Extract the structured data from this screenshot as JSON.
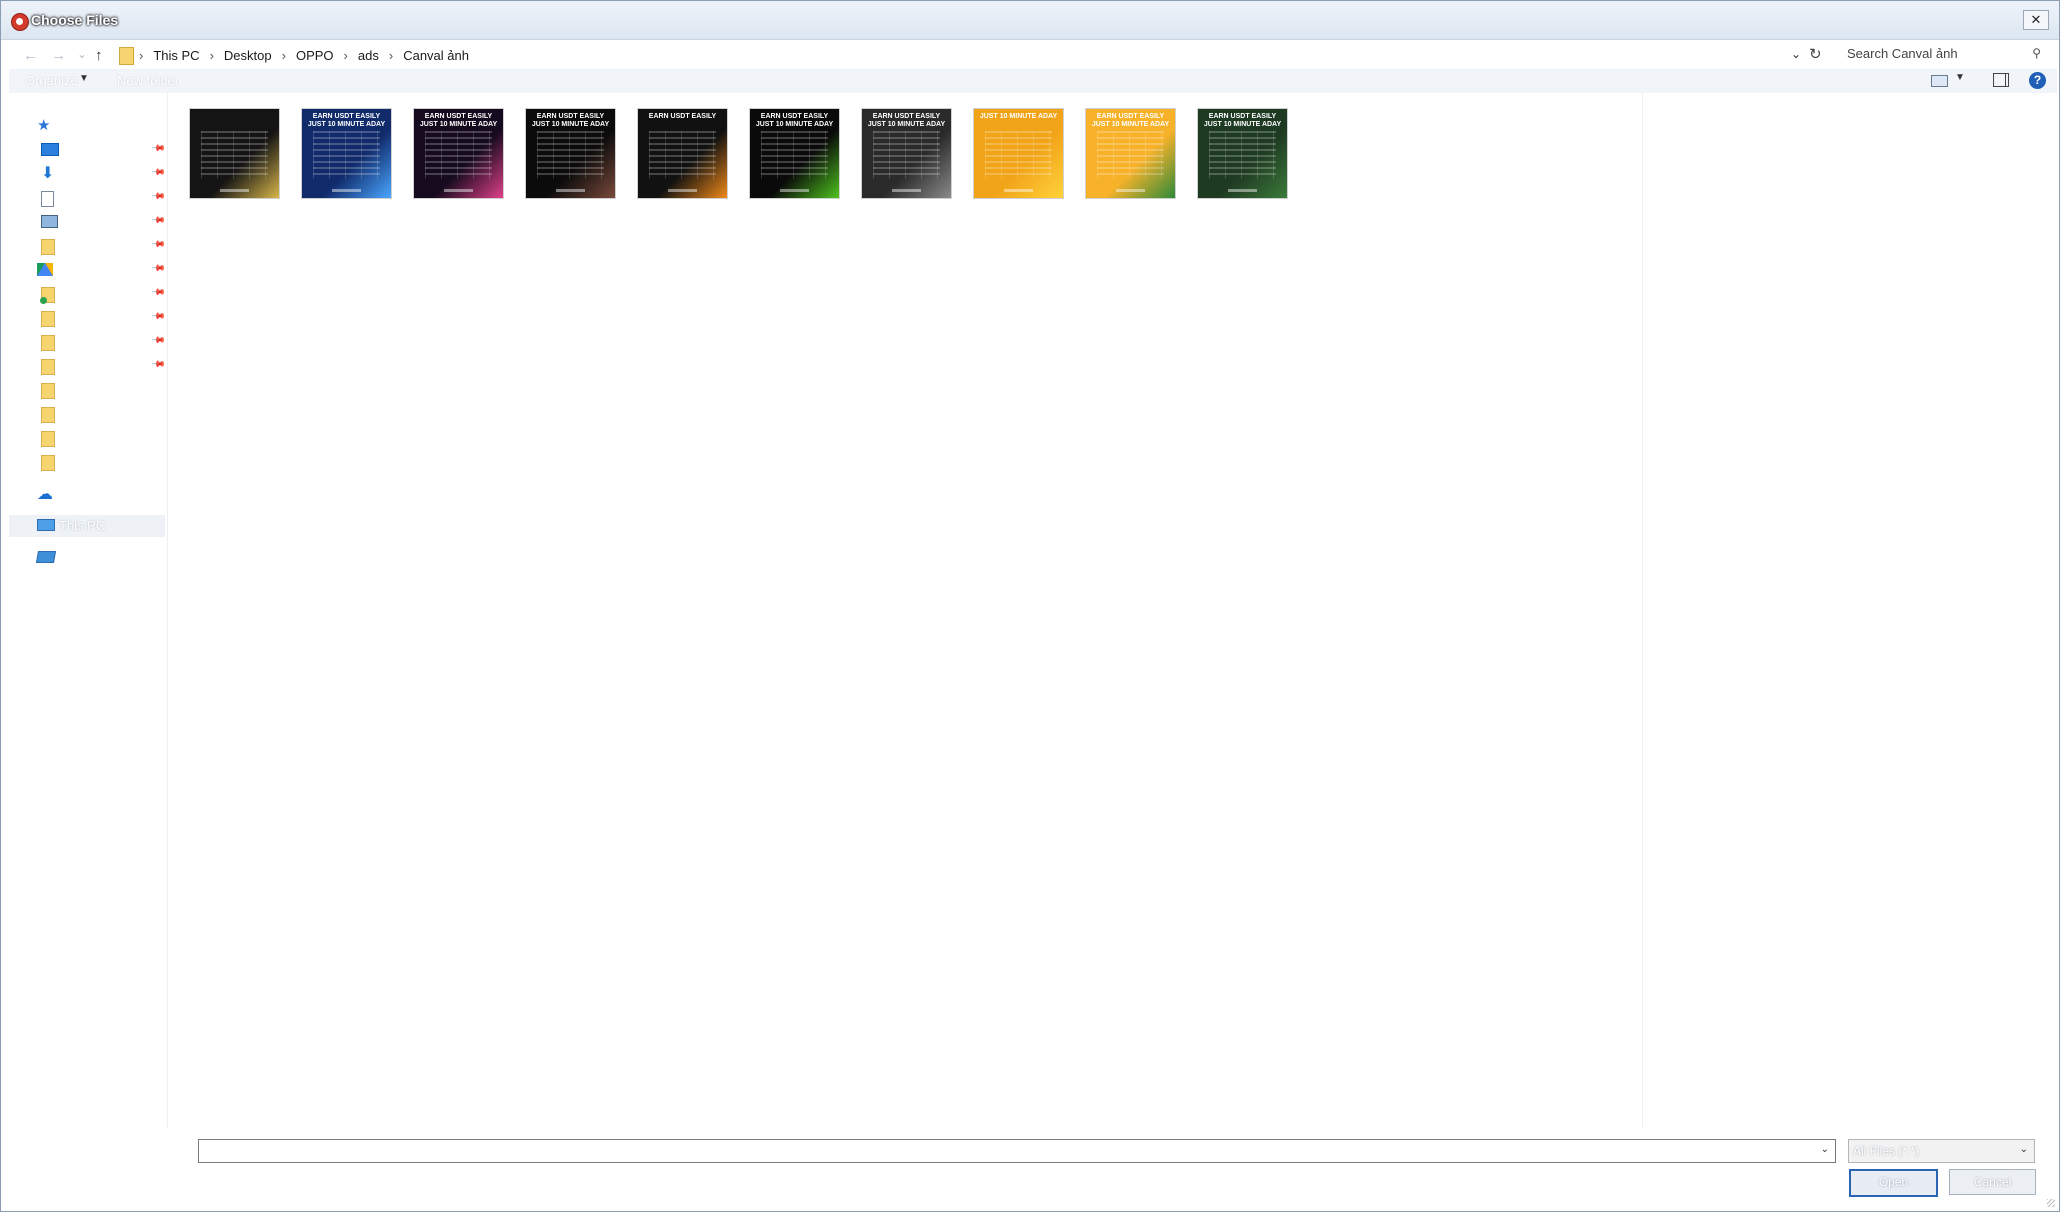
{
  "window": {
    "title": "Choose Files",
    "close_glyph": "✕",
    "app_icon": "chrome-icon"
  },
  "address": {
    "crumbs": [
      "This PC",
      "Desktop",
      "OPPO",
      "ads",
      "Canval ảnh"
    ],
    "sep": "›",
    "back_glyph": "←",
    "forward_glyph": "→",
    "recent_glyph": "⌄",
    "up_glyph": "↑",
    "dropdown_glyph": "⌄",
    "refresh_glyph": "↻"
  },
  "search": {
    "placeholder": "Search Canval ảnh",
    "icon_glyph": "⚲"
  },
  "toolbar": {
    "organize": "Organize",
    "organize_caret": "▼",
    "new_folder": "New folder",
    "view_caret": "▼",
    "help_glyph": "?"
  },
  "navpane": {
    "pin_glyph": "📌",
    "items": [
      {
        "icon": "quick-access-star-icon",
        "glyph": "★",
        "label": "",
        "pinned": false
      },
      {
        "icon": "desktop-icon",
        "label": "",
        "pinned": true
      },
      {
        "icon": "downloads-icon",
        "glyph": "⬇",
        "label": "",
        "pinned": true
      },
      {
        "icon": "documents-icon",
        "label": "",
        "pinned": true
      },
      {
        "icon": "pictures-icon",
        "label": "",
        "pinned": true
      },
      {
        "icon": "folder-icon",
        "label": "",
        "pinned": true
      },
      {
        "icon": "google-drive-icon",
        "label": "",
        "pinned": true
      },
      {
        "icon": "shared-folder-icon",
        "label": "",
        "pinned": true
      },
      {
        "icon": "folder-icon",
        "label": "",
        "pinned": true
      },
      {
        "icon": "folder-icon",
        "label": "",
        "pinned": true
      },
      {
        "icon": "folder-icon",
        "label": "",
        "pinned": true
      },
      {
        "icon": "folder-icon",
        "label": "",
        "pinned": false
      },
      {
        "icon": "folder-icon",
        "label": "",
        "pinned": false
      },
      {
        "icon": "folder-icon",
        "label": "",
        "pinned": false
      },
      {
        "icon": "folder-icon",
        "label": "",
        "pinned": false
      },
      {
        "icon": "onedrive-icon",
        "glyph": "☁",
        "label": "",
        "pinned": false
      },
      {
        "icon": "this-pc-icon",
        "label": "This PC",
        "pinned": false,
        "selected": true
      },
      {
        "icon": "network-icon",
        "label": "",
        "pinned": false
      }
    ]
  },
  "files": [
    {
      "headline": "",
      "bg": "#141414",
      "accent": "#d8b64a"
    },
    {
      "headline": "EARN USDT EASILY JUST 10 MINUTE ADAY",
      "bg": "#102a6a",
      "accent": "#4aa6ff"
    },
    {
      "headline": "EARN USDT EASILY JUST 10 MINUTE ADAY",
      "bg": "#160b1e",
      "accent": "#e0408a"
    },
    {
      "headline": "EARN USDT EASILY JUST 10 MINUTE ADAY",
      "bg": "#0b0b0b",
      "accent": "#7a4a3a"
    },
    {
      "headline": "EARN USDT EASILY",
      "bg": "#111111",
      "accent": "#f08a1a"
    },
    {
      "headline": "EARN USDT EASILY JUST 10 MINUTE ADAY",
      "bg": "#0a0a0a",
      "accent": "#4ec21e"
    },
    {
      "headline": "EARN USDT EASILY JUST 10 MINUTE ADAY",
      "bg": "#2a2a2a",
      "accent": "#8a8a8a"
    },
    {
      "headline": "JUST 10 MINUTE ADAY",
      "bg": "#f2a418",
      "accent": "#ffd23a"
    },
    {
      "headline": "EARN USDT EASILY JUST 10 MINUTE ADAY",
      "bg": "#f7b22a",
      "accent": "#2e8a3a"
    },
    {
      "headline": "EARN USDT EASILY JUST 10 MINUTE ADAY",
      "bg": "#1f3a22",
      "accent": "#3b7a3a"
    }
  ],
  "bottom": {
    "filename_value": "",
    "filename_caret": "⌄",
    "filetype": "All Files (*.*)",
    "filetype_caret": "⌄",
    "open": "Open",
    "cancel": "Cancel"
  }
}
